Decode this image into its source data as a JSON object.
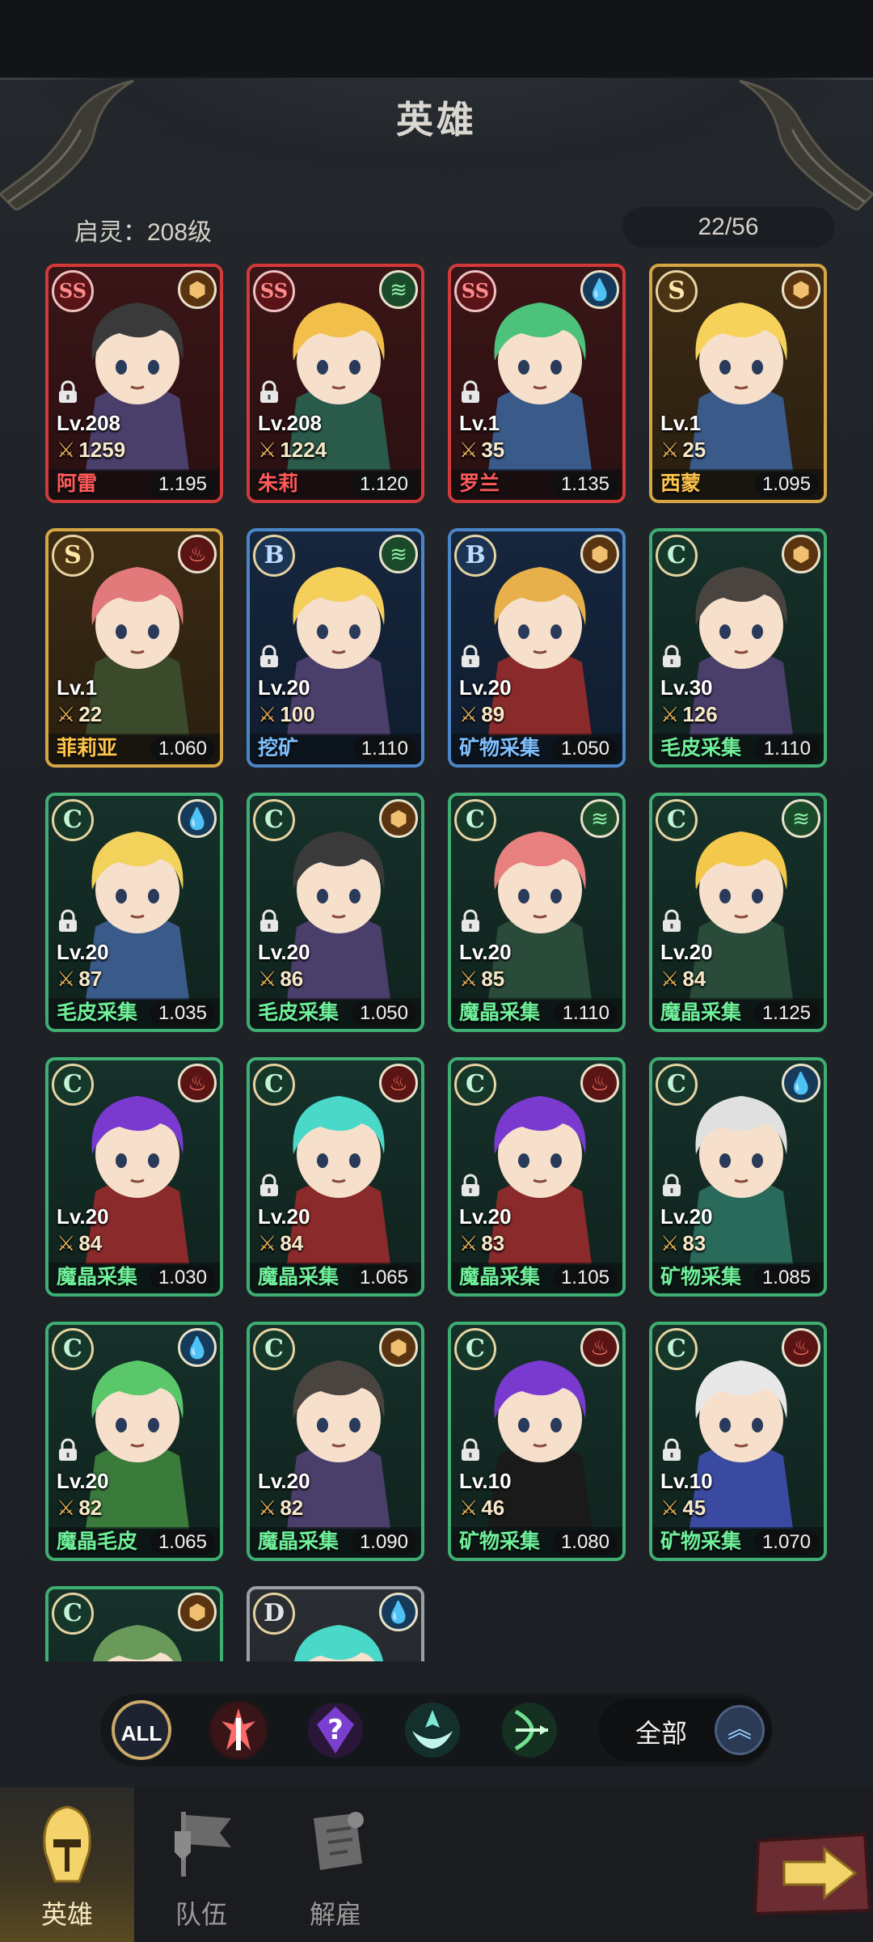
{
  "header": {
    "title": "英雄",
    "awaken_label": "启灵：208级",
    "hero_count": "22/56"
  },
  "colors": {
    "ss_border": "#d23a3a",
    "s_border": "#d6a545",
    "b_border": "#4a86c8",
    "c_border": "#3fae73",
    "d_border": "#9aa0a6"
  },
  "heroes": [
    {
      "rank": "SS",
      "element": "earth",
      "level": "Lv.208",
      "power": "1259",
      "name": "阿雷",
      "rate": "1.195",
      "locked": true
    },
    {
      "rank": "SS",
      "element": "wind",
      "level": "Lv.208",
      "power": "1224",
      "name": "朱莉",
      "rate": "1.120",
      "locked": true
    },
    {
      "rank": "SS",
      "element": "water",
      "level": "Lv.1",
      "power": "35",
      "name": "罗兰",
      "rate": "1.135",
      "locked": true
    },
    {
      "rank": "S",
      "element": "earth",
      "level": "Lv.1",
      "power": "25",
      "name": "西蒙",
      "rate": "1.095",
      "locked": false
    },
    {
      "rank": "S",
      "element": "fire",
      "level": "Lv.1",
      "power": "22",
      "name": "菲莉亚",
      "rate": "1.060",
      "locked": false
    },
    {
      "rank": "B",
      "element": "wind",
      "level": "Lv.20",
      "power": "100",
      "name": "挖矿",
      "rate": "1.110",
      "locked": true
    },
    {
      "rank": "B",
      "element": "earth",
      "level": "Lv.20",
      "power": "89",
      "name": "矿物采集",
      "rate": "1.050",
      "locked": true
    },
    {
      "rank": "C",
      "element": "earth",
      "level": "Lv.30",
      "power": "126",
      "name": "毛皮采集",
      "rate": "1.110",
      "locked": true
    },
    {
      "rank": "C",
      "element": "water",
      "level": "Lv.20",
      "power": "87",
      "name": "毛皮采集",
      "rate": "1.035",
      "locked": true
    },
    {
      "rank": "C",
      "element": "earth",
      "level": "Lv.20",
      "power": "86",
      "name": "毛皮采集",
      "rate": "1.050",
      "locked": true
    },
    {
      "rank": "C",
      "element": "wind",
      "level": "Lv.20",
      "power": "85",
      "name": "魔晶采集",
      "rate": "1.110",
      "locked": true
    },
    {
      "rank": "C",
      "element": "wind",
      "level": "Lv.20",
      "power": "84",
      "name": "魔晶采集",
      "rate": "1.125",
      "locked": true
    },
    {
      "rank": "C",
      "element": "fire",
      "level": "Lv.20",
      "power": "84",
      "name": "魔晶采集",
      "rate": "1.030",
      "locked": false
    },
    {
      "rank": "C",
      "element": "fire",
      "level": "Lv.20",
      "power": "84",
      "name": "魔晶采集",
      "rate": "1.065",
      "locked": true
    },
    {
      "rank": "C",
      "element": "fire",
      "level": "Lv.20",
      "power": "83",
      "name": "魔晶采集",
      "rate": "1.105",
      "locked": true
    },
    {
      "rank": "C",
      "element": "water",
      "level": "Lv.20",
      "power": "83",
      "name": "矿物采集",
      "rate": "1.085",
      "locked": true
    },
    {
      "rank": "C",
      "element": "water",
      "level": "Lv.20",
      "power": "82",
      "name": "魔晶毛皮",
      "rate": "1.065",
      "locked": true
    },
    {
      "rank": "C",
      "element": "earth",
      "level": "Lv.20",
      "power": "82",
      "name": "魔晶采集",
      "rate": "1.090",
      "locked": false
    },
    {
      "rank": "C",
      "element": "fire",
      "level": "Lv.10",
      "power": "46",
      "name": "矿物采集",
      "rate": "1.080",
      "locked": true
    },
    {
      "rank": "C",
      "element": "fire",
      "level": "Lv.10",
      "power": "45",
      "name": "矿物采集",
      "rate": "1.070",
      "locked": true
    },
    {
      "rank": "C",
      "element": "earth",
      "level": "",
      "power": "",
      "name": "",
      "rate": "",
      "locked": false
    },
    {
      "rank": "D",
      "element": "water",
      "level": "",
      "power": "",
      "name": "",
      "rate": "",
      "locked": false
    }
  ],
  "filter": {
    "all_label": "ALL",
    "select_label": "全部",
    "icons": [
      "warrior-class-icon",
      "mage-class-icon",
      "healer-class-icon",
      "archer-class-icon"
    ]
  },
  "nav": {
    "heroes": "英雄",
    "team": "队伍",
    "dismiss": "解雇"
  }
}
